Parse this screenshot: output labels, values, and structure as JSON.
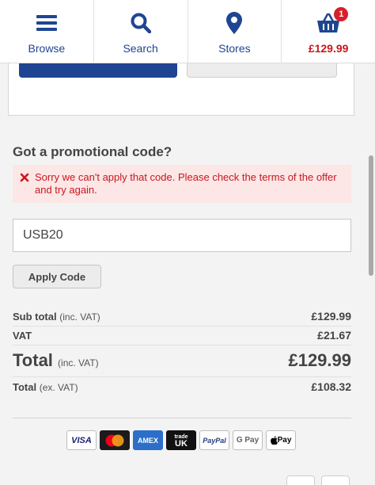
{
  "nav": {
    "browse_label": "Browse",
    "search_label": "Search",
    "stores_label": "Stores",
    "basket_total": "£129.99",
    "basket_count": "1"
  },
  "promo": {
    "title": "Got a promotional code?",
    "error_message": "Sorry we can't apply that code. Please check the terms of the offer and try again.",
    "code_value": "USB20",
    "apply_label": "Apply Code"
  },
  "totals": {
    "subtotal_label": "Sub total",
    "subtotal_note": "(inc. VAT)",
    "subtotal_value": "£129.99",
    "vat_label": "VAT",
    "vat_value": "£21.67",
    "total_label": "Total",
    "total_note": "(inc. VAT)",
    "total_value": "£129.99",
    "total_ex_label": "Total",
    "total_ex_note": "(ex. VAT)",
    "total_ex_value": "£108.32"
  },
  "payments": {
    "visa": "VISA",
    "amex_line1": "AM",
    "amex_line2": "EX",
    "trade_line1": "trade",
    "trade_line2": "UK",
    "paypal": "PayPal",
    "gpay": "G Pay",
    "applepay": "Pay"
  },
  "colors": {
    "brand_blue": "#1f4592",
    "error_red": "#c7181f",
    "price_red": "#c9161d"
  }
}
